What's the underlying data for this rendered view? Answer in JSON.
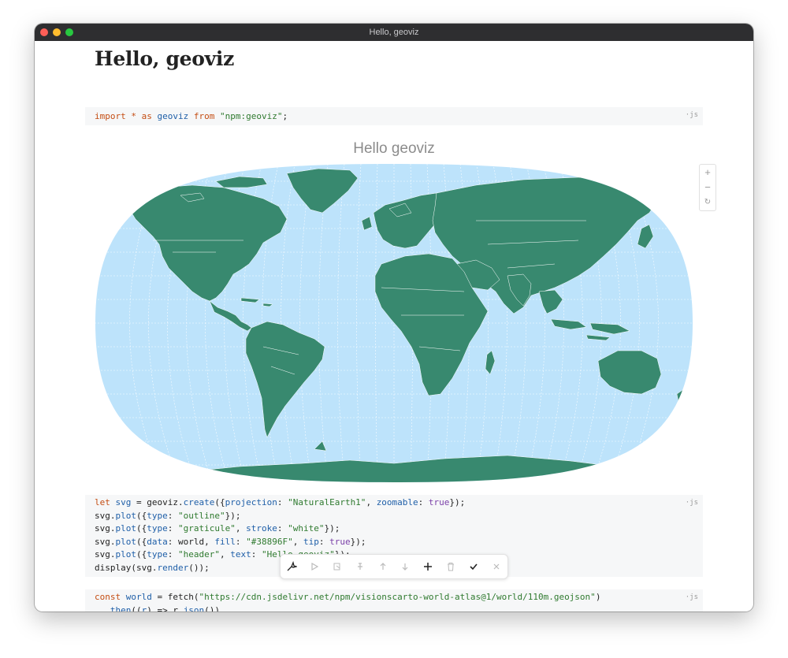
{
  "window": {
    "title": "Hello, geoviz"
  },
  "notebook": {
    "title": "Hello, geoviz"
  },
  "cells": {
    "import": {
      "tag": "·js"
    },
    "plot": {
      "tag": "·js"
    },
    "world": {
      "tag": "·js"
    }
  },
  "map": {
    "title": "Hello geoviz",
    "colors": {
      "ocean": "#bde3fb",
      "land": "#38896F",
      "graticule": "#ffffff"
    }
  },
  "zoom_controls": {
    "in": "+",
    "out": "−",
    "reset": "↻"
  },
  "toolbar": {
    "icons": [
      "ai-assist-icon",
      "run-icon",
      "duplicate-icon",
      "pin-icon",
      "move-up-icon",
      "move-down-icon",
      "add-icon",
      "delete-icon",
      "commit-icon",
      "close-icon"
    ]
  }
}
